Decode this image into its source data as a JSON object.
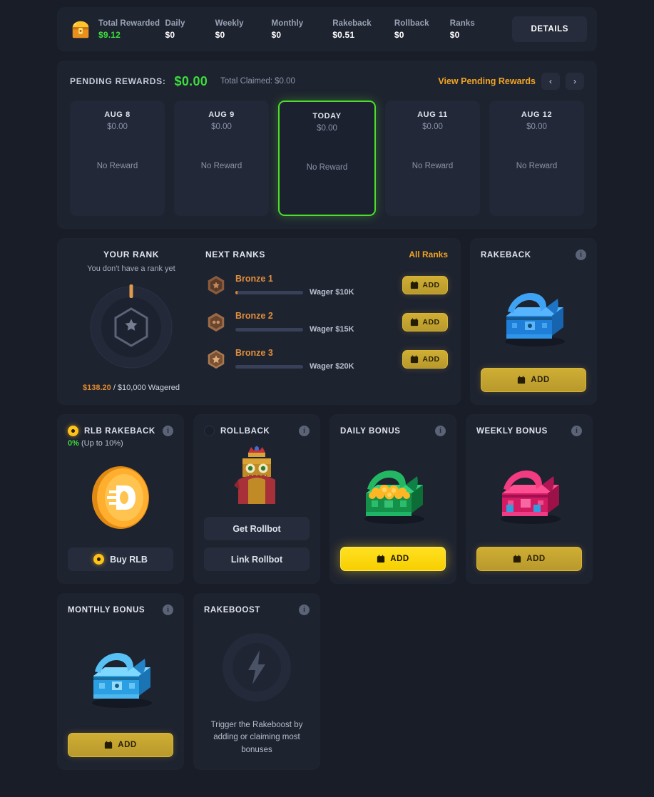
{
  "stats": {
    "chest_icon": "gold-chest-icon",
    "items": [
      {
        "label": "Total Rewarded",
        "value": "$9.12",
        "accent": "green"
      },
      {
        "label": "Daily",
        "value": "$0"
      },
      {
        "label": "Weekly",
        "value": "$0"
      },
      {
        "label": "Monthly",
        "value": "$0"
      },
      {
        "label": "Rakeback",
        "value": "$0.51"
      },
      {
        "label": "Rollback",
        "value": "$0"
      },
      {
        "label": "Ranks",
        "value": "$0"
      }
    ],
    "details_label": "DETAILS"
  },
  "pending": {
    "title": "PENDING REWARDS:",
    "amount": "$0.00",
    "total_claimed": "Total Claimed: $0.00",
    "view_label": "View Pending Rewards",
    "prev_icon": "chevron-left-icon",
    "next_icon": "chevron-right-icon",
    "days": [
      {
        "name": "AUG 8",
        "amount": "$0.00",
        "status": "No Reward",
        "today": false
      },
      {
        "name": "AUG 9",
        "amount": "$0.00",
        "status": "No Reward",
        "today": false
      },
      {
        "name": "TODAY",
        "amount": "$0.00",
        "status": "No Reward",
        "today": true
      },
      {
        "name": "AUG 11",
        "amount": "$0.00",
        "status": "No Reward",
        "today": false
      },
      {
        "name": "AUG 12",
        "amount": "$0.00",
        "status": "No Reward",
        "today": false
      }
    ]
  },
  "your_rank": {
    "title": "YOUR RANK",
    "subtitle": "You don't have a rank yet",
    "progress_wagered": "$138.20",
    "progress_target": " / $10,000 Wagered",
    "badge_icon": "hexagon-star-icon"
  },
  "next_ranks": {
    "title": "NEXT RANKS",
    "all_ranks_label": "All Ranks",
    "items": [
      {
        "name": "Bronze 1",
        "wager": "Wager $10K",
        "add_label": "ADD",
        "badge_icon": "bronze-1-badge-icon"
      },
      {
        "name": "Bronze 2",
        "wager": "Wager $15K",
        "add_label": "ADD",
        "badge_icon": "bronze-2-badge-icon"
      },
      {
        "name": "Bronze 3",
        "wager": "Wager $20K",
        "add_label": "ADD",
        "badge_icon": "bronze-3-badge-icon"
      }
    ]
  },
  "rakeback_card": {
    "title": "RAKEBACK",
    "art_icon": "blue-chest-icon",
    "add_label": "ADD",
    "info_icon": "info-icon"
  },
  "bonus_cards": {
    "rlb_rakeback": {
      "title": "RLB RAKEBACK",
      "percent": "0%",
      "range": " (Up to 10%)",
      "art_icon": "rlb-coin-icon",
      "buy_label": "Buy RLB",
      "info_icon": "info-icon"
    },
    "rollback": {
      "title": "ROLLBACK",
      "art_icon": "rollbot-character-icon",
      "get_label": "Get Rollbot",
      "link_label": "Link Rollbot",
      "info_icon": "info-icon"
    },
    "daily_bonus": {
      "title": "DAILY BONUS",
      "art_icon": "green-chest-icon",
      "add_label": "ADD",
      "info_icon": "info-icon"
    },
    "weekly_bonus": {
      "title": "WEEKLY BONUS",
      "art_icon": "pink-chest-icon",
      "add_label": "ADD",
      "info_icon": "info-icon"
    },
    "monthly_bonus": {
      "title": "MONTHLY BONUS",
      "art_icon": "cyan-chest-icon",
      "add_label": "ADD",
      "info_icon": "info-icon"
    },
    "rakeboost": {
      "title": "RAKEBOOST",
      "art_icon": "lightning-bolt-icon",
      "description": "Trigger the Rakeboost by adding or claiming most bonuses",
      "info_icon": "info-icon"
    }
  },
  "colors": {
    "page_bg": "#191d27",
    "panel_bg": "#1e2330",
    "accent_gold": "#f1a423",
    "accent_green": "#3ddc3d",
    "today_border": "#4ddd2a",
    "rank_orange": "#e08f3c"
  }
}
